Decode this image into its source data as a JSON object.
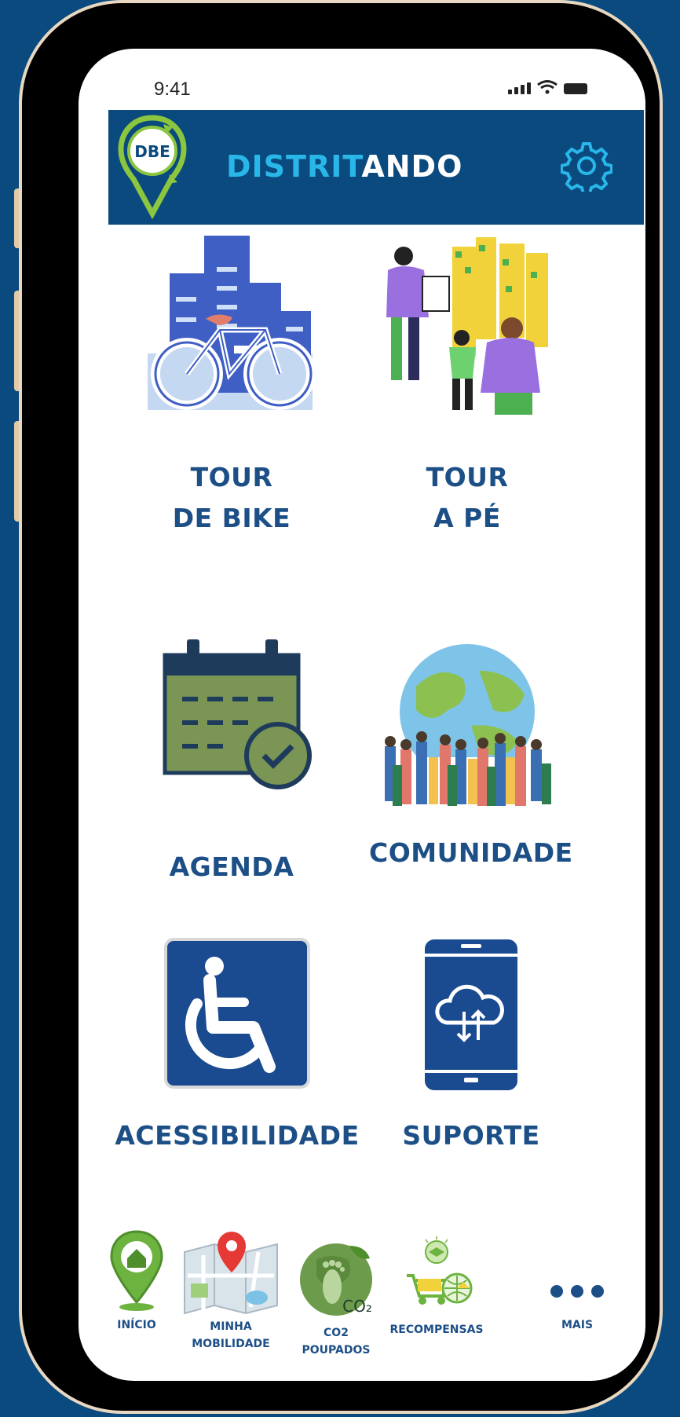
{
  "status_bar": {
    "time": "9:41"
  },
  "header": {
    "logo_text": "DBE",
    "title_part1": "DISTRIT",
    "title_part2": "ANDO"
  },
  "tiles": [
    {
      "line1": "TOUR",
      "line2": "DE BIKE",
      "icon": "city-bike-icon"
    },
    {
      "line1": "TOUR",
      "line2": "A PÉ",
      "icon": "walking-people-icon"
    },
    {
      "line1": "AGENDA",
      "icon": "calendar-check-icon"
    },
    {
      "line1": "COMUNIDADE",
      "icon": "globe-crowd-icon"
    },
    {
      "line1": "ACESSIBILIDADE",
      "icon": "wheelchair-icon"
    },
    {
      "line1": "SUPORTE",
      "icon": "phone-cloud-icon"
    }
  ],
  "bottom_nav": [
    {
      "line1": "INÍCIO",
      "icon": "home-pin-icon"
    },
    {
      "line1": "MINHA",
      "line2": "MOBILIDADE",
      "icon": "map-pin-icon"
    },
    {
      "line1": "CO2",
      "line2": "POUPADOS",
      "icon": "footprint-globe-icon",
      "badge": "CO₂"
    },
    {
      "line1": "RECOMPENSAS",
      "icon": "rewards-icon"
    },
    {
      "line1": "MAIS",
      "icon": "more-dots-icon"
    }
  ],
  "colors": {
    "brand_blue": "#0a4a7e",
    "title_cyan": "#29b6e8",
    "label_blue": "#1d4f87",
    "logo_green": "#8cc63f"
  }
}
